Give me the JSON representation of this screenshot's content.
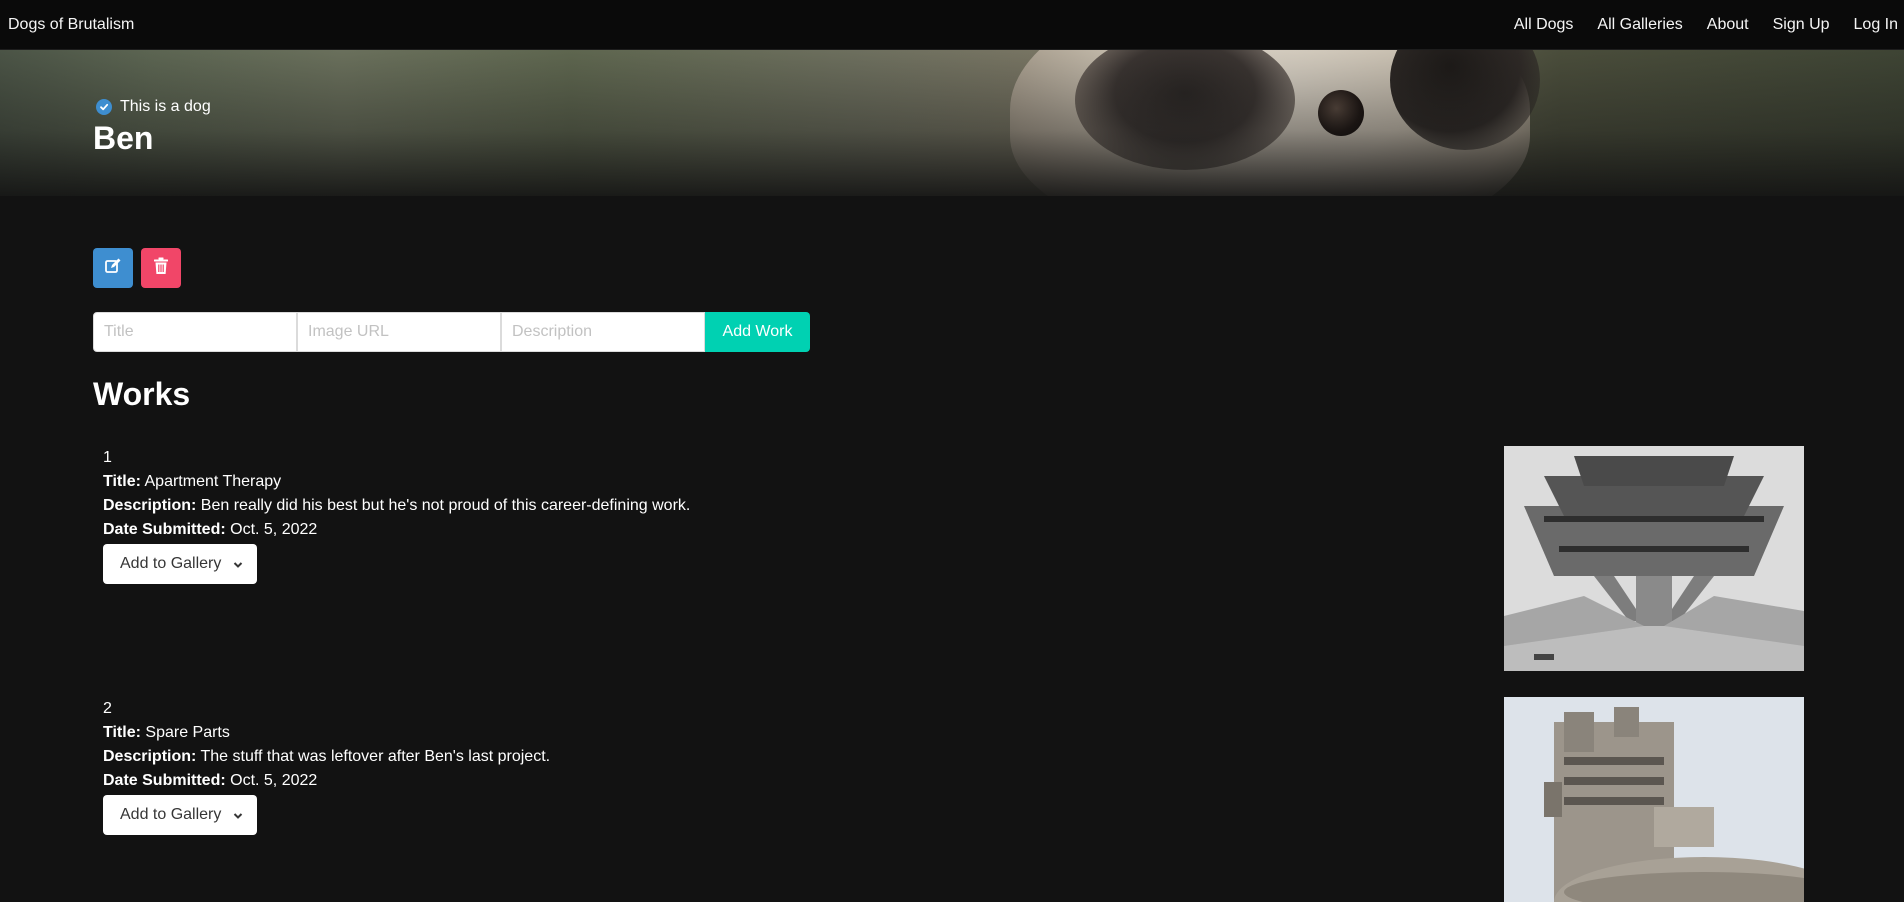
{
  "navbar": {
    "brand": "Dogs of Brutalism",
    "links": [
      "All Dogs",
      "All Galleries",
      "About",
      "Sign Up",
      "Log In"
    ]
  },
  "hero": {
    "verified_text": "This is a dog",
    "dog_name": "Ben"
  },
  "actions": {
    "edit_icon": "edit-icon",
    "delete_icon": "trash-icon"
  },
  "form": {
    "title_placeholder": "Title",
    "image_placeholder": "Image URL",
    "description_placeholder": "Description",
    "submit_label": "Add Work"
  },
  "works": {
    "heading": "Works",
    "labels": {
      "title": "Title:",
      "description": "Description:",
      "date": "Date Submitted:"
    },
    "items": [
      {
        "number": "1",
        "title": "Apartment Therapy",
        "description": "Ben really did his best but he's not proud of this career-defining work.",
        "date": "Oct. 5, 2022",
        "gallery_label": "Add to Gallery"
      },
      {
        "number": "2",
        "title": "Spare Parts",
        "description": "The stuff that was leftover after Ben's last project.",
        "date": "Oct. 5, 2022",
        "gallery_label": "Add to Gallery"
      }
    ]
  },
  "colors": {
    "background": "#121212",
    "navbar": "#0a0a0a",
    "info": "#3e8ed0",
    "danger": "#f14668",
    "primary": "#00d1b2"
  }
}
